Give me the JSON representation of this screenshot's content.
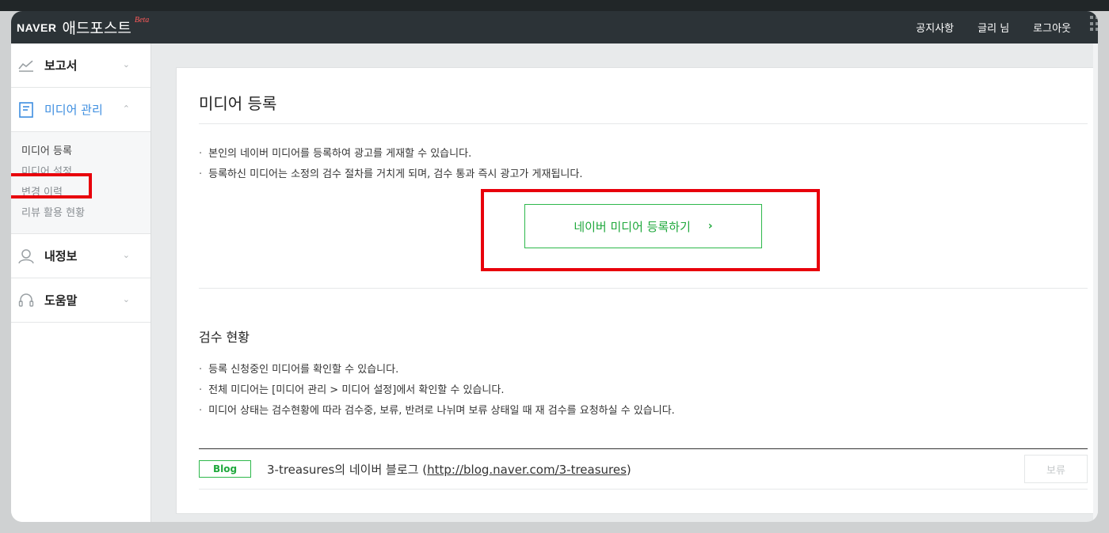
{
  "header": {
    "brand": "NAVER",
    "service": "애드포스트",
    "beta": "Beta",
    "nav": [
      "공지사항",
      "글리 님",
      "로그아웃"
    ]
  },
  "sidebar": {
    "items": [
      {
        "label": "보고서",
        "icon": "chart-line-icon"
      },
      {
        "label": "미디어 관리",
        "icon": "document-icon",
        "active": true
      },
      {
        "label": "내정보",
        "icon": "user-icon"
      },
      {
        "label": "도움말",
        "icon": "headset-icon"
      }
    ],
    "submenu": [
      "미디어 등록",
      "미디어 설정",
      "변경 이력",
      "리뷰 활용 현황"
    ]
  },
  "main": {
    "title": "미디어 등록",
    "notes": [
      "본인의 네이버 미디어를 등록하여 광고를 게재할 수 있습니다.",
      "등록하신 미디어는 소정의 검수 절차를 거치게 되며, 검수 통과 즉시 광고가 게재됩니다."
    ],
    "register_button": "네이버 미디어 등록하기",
    "review_title": "검수 현황",
    "review_notes": [
      "등록 신청중인 미디어를 확인할 수 있습니다.",
      "전체 미디어는 [미디어 관리 > 미디어 설정]에서 확인할 수 있습니다.",
      "미디어 상태는 검수현황에 따라 검수중, 보류, 반려로 나뉘며 보류 상태일 때 재 검수를 요청하실 수 있습니다."
    ],
    "media": {
      "badge": "Blog",
      "name": "3-treasures의 네이버 블로그 (",
      "url": "http://blog.naver.com/3-treasures",
      "suffix": ")",
      "status": "보류"
    }
  },
  "colors": {
    "accent_green": "#1fa83c",
    "active_blue": "#3d8ee0",
    "highlight_red": "#e8000b"
  }
}
